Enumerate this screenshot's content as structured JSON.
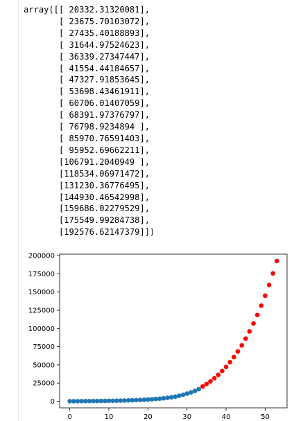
{
  "array_output": {
    "lines": [
      "array([[ 20332.31320081],",
      "       [ 23675.70103072],",
      "       [ 27435.40188893],",
      "       [ 31644.97524623],",
      "       [ 36339.27347447],",
      "       [ 41554.44184657],",
      "       [ 47327.91853645],",
      "       [ 53698.43461911],",
      "       [ 60706.01407059],",
      "       [ 68391.97376797],",
      "       [ 76798.9234894 ],",
      "       [ 85970.76591403],",
      "       [ 95952.69662211],",
      "       [106791.2040949 ],",
      "       [118534.06971472],",
      "       [131230.36776495],",
      "       [144930.46542998],",
      "       [159686.02279529],",
      "       [175549.99284738],",
      "       [192576.62147379]])"
    ]
  },
  "chart_data": {
    "type": "scatter",
    "xlim": [
      -2.6,
      55.6
    ],
    "ylim": [
      -9000,
      202000
    ],
    "xticks": [
      0,
      10,
      20,
      30,
      40,
      50
    ],
    "yticks": [
      0,
      25000,
      50000,
      75000,
      100000,
      125000,
      150000,
      175000,
      200000
    ],
    "grid": false,
    "series": [
      {
        "color": "#1f77b4",
        "x": [
          0,
          1,
          2,
          3,
          4,
          5,
          6,
          7,
          8,
          9,
          10,
          11,
          12,
          13,
          14,
          15,
          16,
          17,
          18,
          19,
          20,
          21,
          22,
          23,
          24,
          25,
          26,
          27,
          28,
          29,
          30,
          31,
          32,
          33
        ],
        "y": [
          100,
          120,
          150,
          180,
          220,
          260,
          310,
          370,
          440,
          520,
          610,
          710,
          820,
          950,
          1100,
          1250,
          1400,
          1600,
          1850,
          2100,
          2400,
          2750,
          3150,
          3600,
          4150,
          4800,
          5500,
          6400,
          7600,
          9000,
          10500,
          12200,
          14100,
          16600
        ]
      },
      {
        "color": "#ff0000",
        "x": [
          34,
          35,
          36,
          37,
          38,
          39,
          40,
          41,
          42,
          43,
          44,
          45,
          46,
          47,
          48,
          49,
          50,
          51,
          52,
          53
        ],
        "y": [
          20332.31,
          23675.7,
          27435.4,
          31644.98,
          36339.27,
          41554.44,
          47327.92,
          53698.43,
          60706.01,
          68391.97,
          76798.92,
          85970.77,
          95952.7,
          106791.2,
          118534.07,
          131230.37,
          144930.47,
          159686.02,
          175549.99,
          192576.62
        ]
      }
    ]
  }
}
